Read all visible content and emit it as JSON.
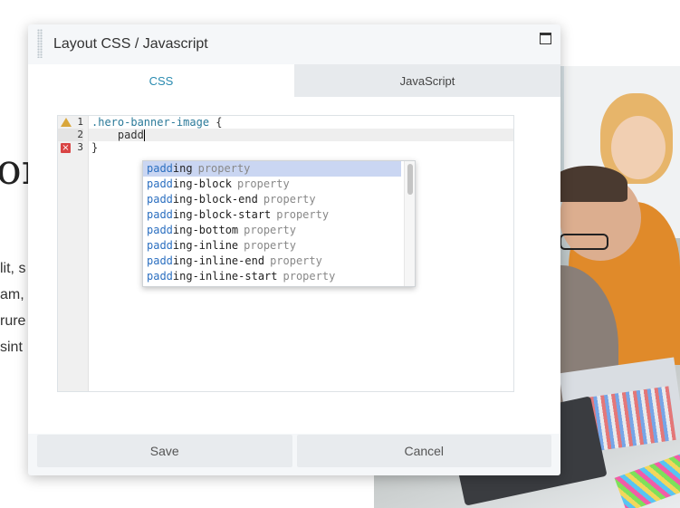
{
  "background": {
    "heading_fragment": "or",
    "text_lines": [
      "lit, s",
      "am,",
      "rure",
      "sint"
    ]
  },
  "dialog": {
    "title": "Layout CSS / Javascript",
    "maximize_icon": "maximize-icon",
    "tabs": [
      {
        "label": "CSS",
        "active": true
      },
      {
        "label": "JavaScript",
        "active": false
      }
    ],
    "editor": {
      "line_numbers": [
        "1",
        "2",
        "3"
      ],
      "line_markers": [
        "warning",
        "none",
        "error"
      ],
      "lines": [
        {
          "selector": ".hero-banner-image",
          "rest": " {"
        },
        {
          "indent": "    ",
          "text": "padd"
        },
        {
          "text": "}"
        }
      ]
    },
    "autocomplete": {
      "typed": "padd",
      "items": [
        {
          "match": "padd",
          "rest": "ing",
          "type": "property",
          "selected": true
        },
        {
          "match": "padd",
          "rest": "ing-block",
          "type": "property"
        },
        {
          "match": "padd",
          "rest": "ing-block-end",
          "type": "property"
        },
        {
          "match": "padd",
          "rest": "ing-block-start",
          "type": "property"
        },
        {
          "match": "padd",
          "rest": "ing-bottom",
          "type": "property"
        },
        {
          "match": "padd",
          "rest": "ing-inline",
          "type": "property"
        },
        {
          "match": "padd",
          "rest": "ing-inline-end",
          "type": "property"
        },
        {
          "match": "padd",
          "rest": "ing-inline-start",
          "type": "property"
        }
      ]
    },
    "buttons": {
      "save": "Save",
      "cancel": "Cancel"
    },
    "colors": {
      "accent": "#2a8bb0",
      "selected_suggestion": "#cad6f2",
      "warning": "#d9a63a",
      "error": "#d94444"
    }
  }
}
